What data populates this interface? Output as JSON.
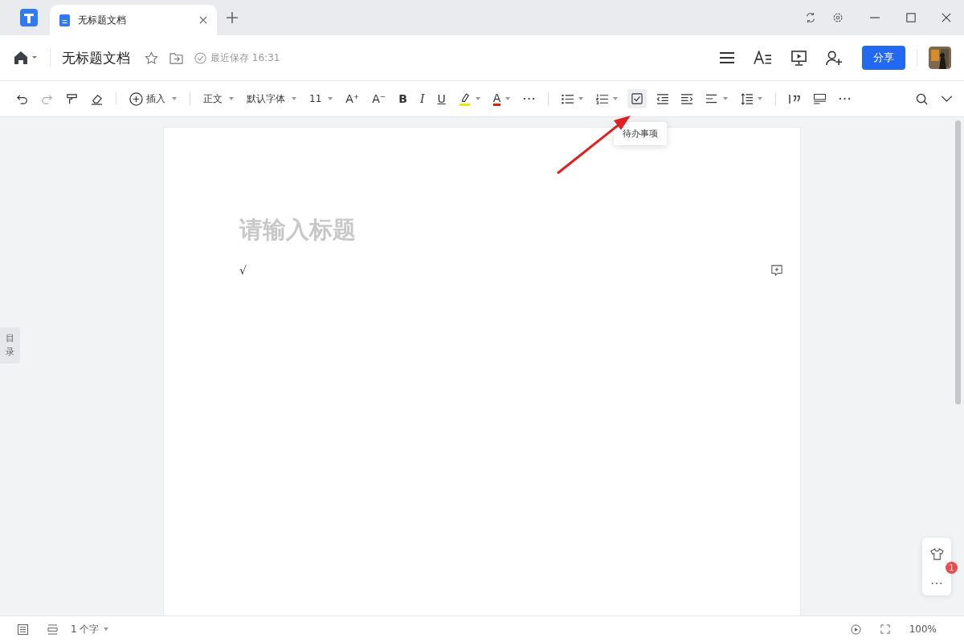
{
  "window": {
    "tabs": [
      {
        "label": "无标题文档",
        "selected": true
      }
    ]
  },
  "header": {
    "title": "无标题文档",
    "save_status": "最近保存 16:31",
    "share_button": "分享"
  },
  "toolbar": {
    "insert": "插入",
    "style": "正文",
    "font": "默认字体",
    "size": "11",
    "font_size_buttons": [
      "A⁺",
      "A⁻"
    ],
    "format_letters": [
      "B",
      "I",
      "U"
    ],
    "font_color_letter": "A",
    "todo_selected": true
  },
  "tooltip": "待办事项",
  "outline_tab": "目录",
  "document": {
    "title_placeholder": "请输入标题",
    "body": "√"
  },
  "status_bar": {
    "word_count": "1 个字",
    "zoom": "100%"
  },
  "float_panel": {
    "badge": "1"
  }
}
